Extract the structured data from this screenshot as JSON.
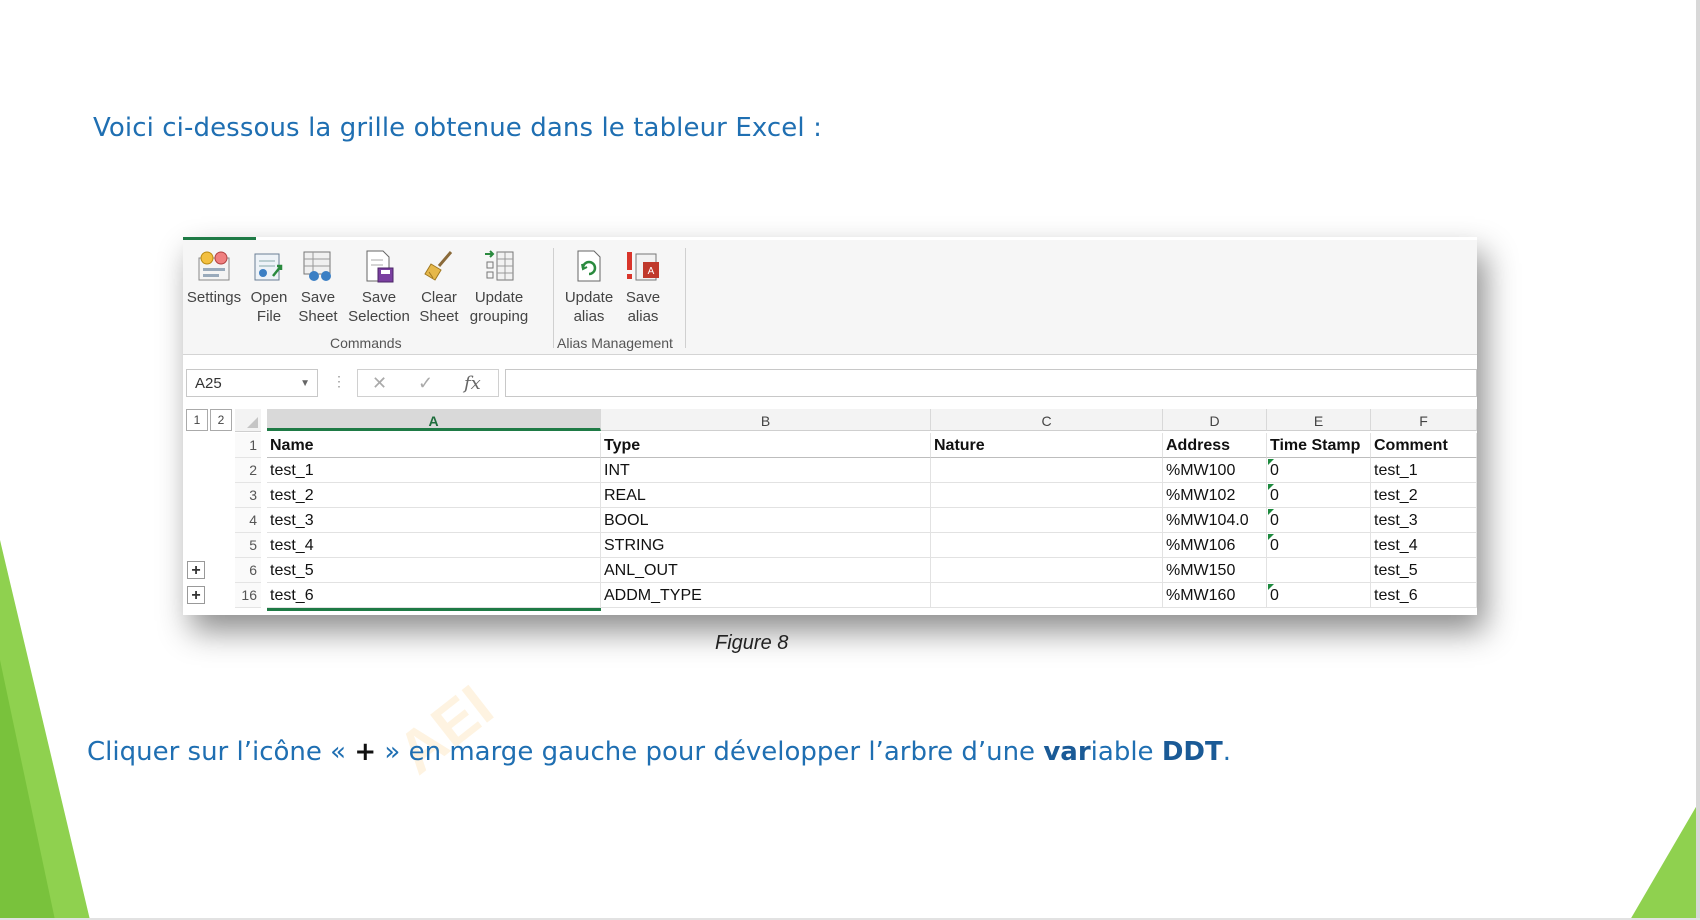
{
  "intro_text": "Voici ci-dessous la grille obtenue dans le tableur Excel :",
  "ribbon": {
    "buttons": [
      {
        "id": "settings",
        "line1": "Settings",
        "line2": "",
        "icon": "settings-icon"
      },
      {
        "id": "open",
        "line1": "Open",
        "line2": "File",
        "icon": "open-file-icon"
      },
      {
        "id": "save-sheet",
        "line1": "Save",
        "line2": "Sheet",
        "icon": "save-sheet-icon"
      },
      {
        "id": "save-selection",
        "line1": "Save",
        "line2": "Selection",
        "icon": "save-selection-icon"
      },
      {
        "id": "clear-sheet",
        "line1": "Clear",
        "line2": "Sheet",
        "icon": "broom-icon"
      },
      {
        "id": "update-grouping",
        "line1": "Update",
        "line2": "grouping",
        "icon": "grouping-icon"
      },
      {
        "id": "update-alias",
        "line1": "Update",
        "line2": "alias",
        "icon": "refresh-doc-icon"
      },
      {
        "id": "save-alias",
        "line1": "Save",
        "line2": "alias",
        "icon": "save-alias-icon"
      }
    ],
    "groups": [
      "Commands",
      "Alias Management"
    ]
  },
  "formula_bar": {
    "name_box": "A25",
    "fx": "fx"
  },
  "outline_levels": [
    "1",
    "2"
  ],
  "columns": [
    "A",
    "B",
    "C",
    "D",
    "E",
    "F"
  ],
  "header_row": {
    "num": "1",
    "cells": [
      "Name",
      "Type",
      "Nature",
      "Address",
      "Time Stamp",
      "Comment"
    ]
  },
  "rows": [
    {
      "num": "2",
      "expand": false,
      "cells": [
        "test_1",
        "INT",
        "",
        "%MW100",
        "0",
        "test_1"
      ]
    },
    {
      "num": "3",
      "expand": false,
      "cells": [
        "test_2",
        "REAL",
        "",
        "%MW102",
        "0",
        "test_2"
      ]
    },
    {
      "num": "4",
      "expand": false,
      "cells": [
        "test_3",
        "BOOL",
        "",
        "%MW104.0",
        "0",
        "test_3"
      ]
    },
    {
      "num": "5",
      "expand": false,
      "cells": [
        "test_4",
        "STRING",
        "",
        "%MW106",
        "0",
        "test_4"
      ]
    },
    {
      "num": "6",
      "expand": true,
      "cells": [
        "test_5",
        "ANL_OUT",
        "",
        "%MW150",
        "",
        "test_5"
      ]
    },
    {
      "num": "16",
      "expand": true,
      "cells": [
        "test_6",
        "ADDM_TYPE",
        "",
        "%MW160",
        "0",
        "test_6"
      ]
    }
  ],
  "caption": "Figure 8",
  "instruction": {
    "part1": "Cliquer sur l’icône « ",
    "plus": "+",
    "part2": " » en marge gauche pour développer l’arbre d’une ",
    "bold1": "var",
    "part3": "iable ",
    "bold2": "DDT",
    "part4": "."
  },
  "watermark": "AEI",
  "colors": {
    "text_blue": "#1f6fb2",
    "excel_green": "#1e7a45",
    "deco_green": "#8fd14f"
  }
}
